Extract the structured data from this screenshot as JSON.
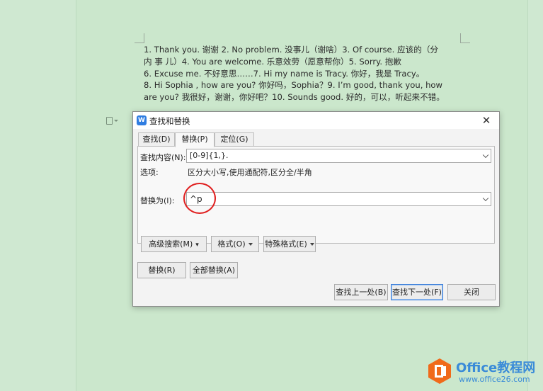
{
  "document": {
    "lines": [
      "1.     Thank you. 谢谢 2.       No problem. 没事儿（谢啥）3.       Of course. 应该的（分",
      "内 事 儿）4.        You are welcome. 乐意效劳（愿意帮你）5.        Sorry. 抱歉",
      "6.       Excuse me. 不好意思……7.        Hi my name is Tracy. 你好，我是 Tracy。",
      "8.       Hi Sophia , how are you? 你好吗，Sophia？9.       I’m good, thank you, how",
      "are you? 我很好，谢谢，你好吧？10.     Sounds good. 好的，可以，听起来不错。"
    ]
  },
  "dialog": {
    "title": "查找和替换",
    "close": "✕",
    "tabs": [
      {
        "label": "查找(D)"
      },
      {
        "label": "替换(P)"
      },
      {
        "label": "定位(G)"
      }
    ],
    "find_label": "查找内容(N):",
    "find_value": "[0-9]{1,}.",
    "options_label": "选项:",
    "options_value": "区分大小写,使用通配符,区分全/半角",
    "replace_label": "替换为(I):",
    "replace_value": "^p",
    "advanced_search": "高级搜索(M)",
    "format": "格式(O)",
    "special_format": "特殊格式(E)",
    "replace_btn": "替换(R)",
    "replace_all_btn": "全部替换(A)",
    "find_prev_btn": "查找上一处(B)",
    "find_next_btn": "查找下一处(F)",
    "close_btn": "关闭"
  },
  "watermark": {
    "brand": "Office教程网",
    "url": "www.office26.com"
  },
  "colors": {
    "background": "#cde8cf",
    "accent": "#3b7ed8",
    "highlight": "#e02020",
    "watermark_orange": "#f06a1a"
  }
}
